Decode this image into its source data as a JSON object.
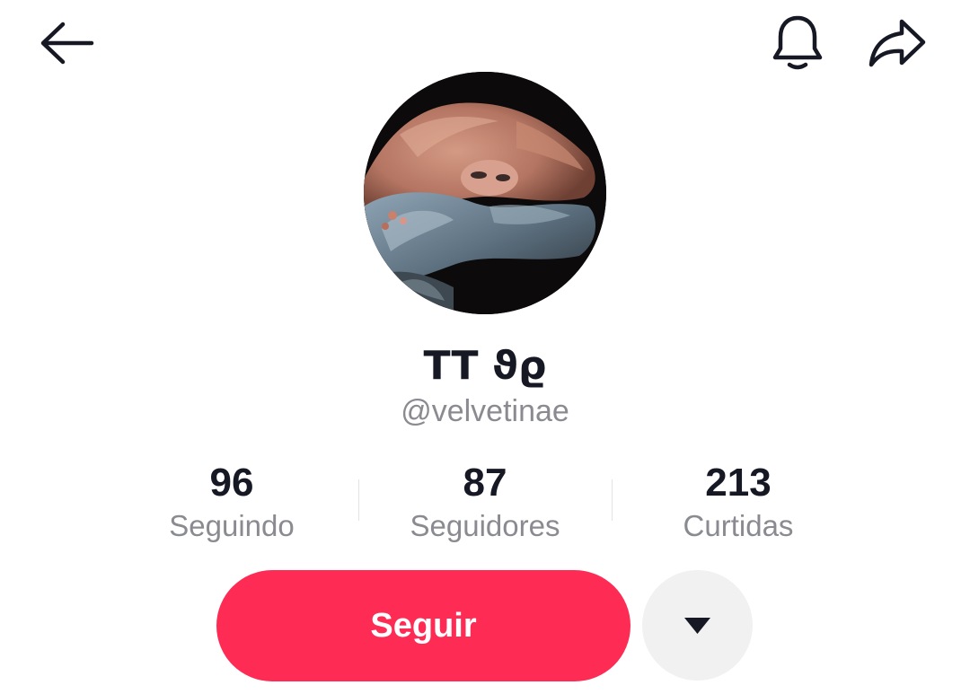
{
  "header": {
    "back_icon": "arrow-left-icon",
    "notification_icon": "bell-icon",
    "share_icon": "share-arrow-icon"
  },
  "profile": {
    "display_name": "TT ϑϱ",
    "username": "@velvetinae",
    "avatar_icon": "profile-photo"
  },
  "stats": [
    {
      "value": "96",
      "label": "Seguindo"
    },
    {
      "value": "87",
      "label": "Seguidores"
    },
    {
      "value": "213",
      "label": "Curtidas"
    }
  ],
  "actions": {
    "follow_label": "Seguir",
    "more_icon": "caret-down-icon"
  },
  "colors": {
    "accent": "#fe2c55",
    "text_primary": "#161823",
    "text_secondary": "#8a8b91",
    "button_secondary_bg": "#f1f1f2"
  }
}
